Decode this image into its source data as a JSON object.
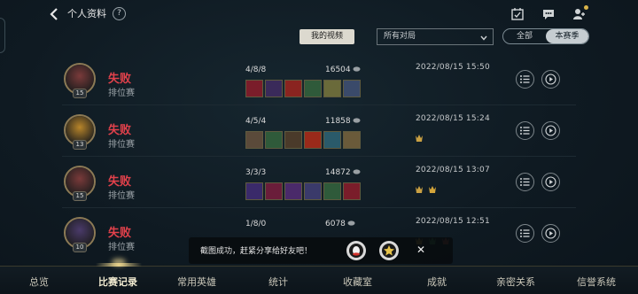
{
  "header": {
    "title": "个人资料",
    "help_glyph": "?"
  },
  "filters": {
    "my_video_label": "我的视频",
    "match_select_value": "所有对局",
    "segment_all": "全部",
    "segment_season": "本赛季"
  },
  "matches": [
    {
      "result": "失败",
      "mode": "排位赛",
      "level": "15",
      "kda": "4/8/8",
      "gold": "16504",
      "date": "2022/08/15 15:50",
      "avatar_color": "#7a3a3a",
      "items": [
        "#7a1d2a",
        "#3a2a5a",
        "#8a2420",
        "#2f5a3a",
        "#6a6a3a",
        "#3a4a6a"
      ],
      "honors": []
    },
    {
      "result": "失败",
      "mode": "排位赛",
      "level": "13",
      "kda": "4/5/4",
      "gold": "11858",
      "date": "2022/08/15 15:24",
      "avatar_color": "#b8852a",
      "items": [
        "#5a4a3a",
        "#2f5a3a",
        "#4a3a2a",
        "#9a2a1a",
        "#2a5a6a",
        "#6a5a3a"
      ],
      "honors": [
        "#c9a043"
      ]
    },
    {
      "result": "失败",
      "mode": "排位赛",
      "level": "15",
      "kda": "3/3/3",
      "gold": "14872",
      "date": "2022/08/15 13:07",
      "avatar_color": "#7a3a3a",
      "items": [
        "#3a2a6a",
        "#6a1d3a",
        "#4a2a6a",
        "#3a3a6a",
        "#2f5a3a",
        "#7a1d2a"
      ],
      "honors": [
        "#c9a043",
        "#d4a53a"
      ]
    },
    {
      "result": "失败",
      "mode": "排位赛",
      "level": "10",
      "kda": "1/8/0",
      "gold": "6078",
      "date": "2022/08/15 12:51",
      "avatar_color": "#4a3a6a",
      "items": [],
      "honors": [
        "#c9a043",
        "#3f8a4a",
        "#b04a3a"
      ]
    }
  ],
  "toast": {
    "text": "截图成功，赶紧分享给好友吧！",
    "close_glyph": "✕"
  },
  "nav": {
    "items": [
      "总览",
      "比赛记录",
      "常用英雄",
      "统计",
      "收藏室",
      "成就",
      "亲密关系",
      "信誉系统"
    ]
  },
  "colors": {
    "loss": "#e0414b",
    "accent_gold": "#e6d08a"
  },
  "icons": {
    "back": "chevron-left-icon",
    "help": "question-circle-icon",
    "calendar": "calendar-check-icon",
    "chat": "chat-bubble-icon",
    "friends": "add-friend-icon",
    "detail": "list-icon",
    "replay": "play-icon",
    "gold": "gold-coin-icon",
    "share_qq": "qq-share-icon",
    "share_wechat": "star-share-icon"
  }
}
